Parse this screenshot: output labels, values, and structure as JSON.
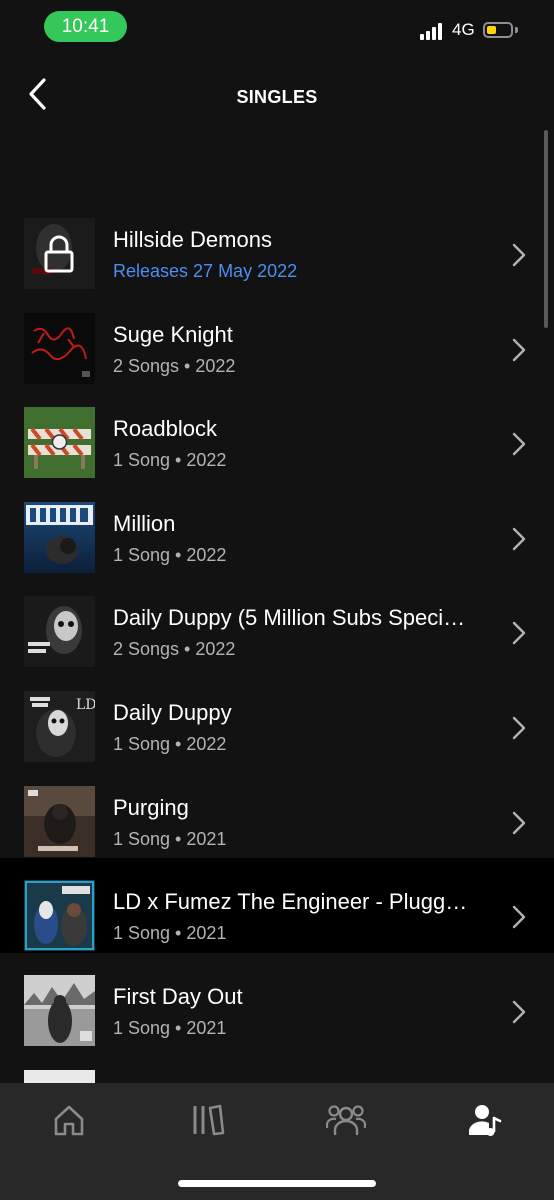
{
  "status_bar": {
    "time": "10:41",
    "network": "4G"
  },
  "header": {
    "title": "SINGLES"
  },
  "colors": {
    "background": "#121212",
    "nav": "#282828",
    "accent_release": "#4d8ef0",
    "secondary_text": "#b3b3b3"
  },
  "singles": [
    {
      "title": "Hillside Demons",
      "subtitle": "Releases 27 May 2022",
      "locked": true
    },
    {
      "title": "Suge Knight",
      "subtitle": "2 Songs • 2022"
    },
    {
      "title": "Roadblock",
      "subtitle": "1 Song • 2022"
    },
    {
      "title": "Million",
      "subtitle": "1 Song • 2022"
    },
    {
      "title": "Daily Duppy (5 Million Subs Speci…",
      "subtitle": "2 Songs • 2022"
    },
    {
      "title": "Daily Duppy",
      "subtitle": "1 Song • 2022"
    },
    {
      "title": "Purging",
      "subtitle": "1 Song • 2021"
    },
    {
      "title": "LD x Fumez The Engineer - Plugg…",
      "subtitle": "1 Song • 2021"
    },
    {
      "title": "First Day Out",
      "subtitle": "1 Song • 2021"
    }
  ],
  "bottom_nav": {
    "items": [
      {
        "icon": "home-icon"
      },
      {
        "icon": "library-icon"
      },
      {
        "icon": "friends-icon"
      },
      {
        "icon": "artist-icon",
        "active": true
      }
    ]
  }
}
